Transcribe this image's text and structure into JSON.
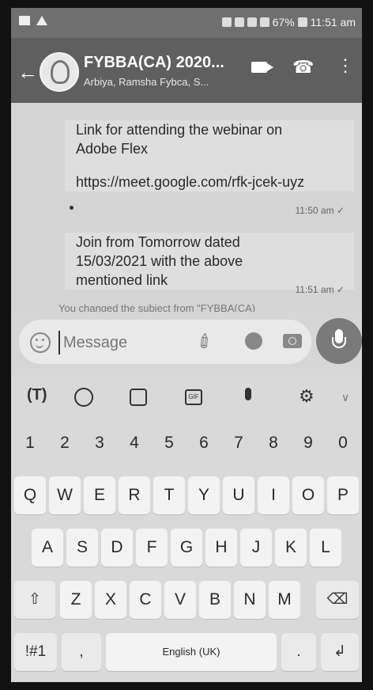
{
  "status_bar": {
    "battery": "67%",
    "time": "11:51 am"
  },
  "chat_header": {
    "title": "FYBBA(CA) 2020...",
    "subtitle": "Arbiya, Ramsha Fybca, S..."
  },
  "messages": [
    {
      "text": "Link for attending the webinar on Adobe Flex",
      "link": "https://meet.google.com/rfk-jcek-uyz",
      "trailing": ".",
      "time": "11:50 am ✓"
    },
    {
      "text": "Join from Tomorrow dated 15/03/2021 with the above mentioned link",
      "time": "11:51 am ✓"
    }
  ],
  "system_note": "You changed the subject from \"FYBBA(CA)",
  "composer": {
    "placeholder": "Message"
  },
  "keyboard": {
    "row_numbers": [
      "1",
      "2",
      "3",
      "4",
      "5",
      "6",
      "7",
      "8",
      "9",
      "0"
    ],
    "row_q": [
      "Q",
      "W",
      "E",
      "R",
      "T",
      "Y",
      "U",
      "I",
      "O",
      "P"
    ],
    "row_a": [
      "A",
      "S",
      "D",
      "F",
      "G",
      "H",
      "J",
      "K",
      "L"
    ],
    "row_z": [
      "Z",
      "X",
      "C",
      "V",
      "B",
      "N",
      "M"
    ],
    "symbols_label": "!#1",
    "comma_label": ",",
    "space_label": "English (UK)",
    "period_label": ".",
    "shift_glyph": "⇧",
    "backspace_glyph": "⌫",
    "enter_glyph": "↲",
    "toolbar_t": "(T)",
    "toolbar_gif": "GIF",
    "toolbar_gear": "⚙",
    "toolbar_chevron": "∨"
  },
  "icons": {
    "back": "←",
    "call": "☎",
    "more": "⋮",
    "attach": "✐"
  }
}
